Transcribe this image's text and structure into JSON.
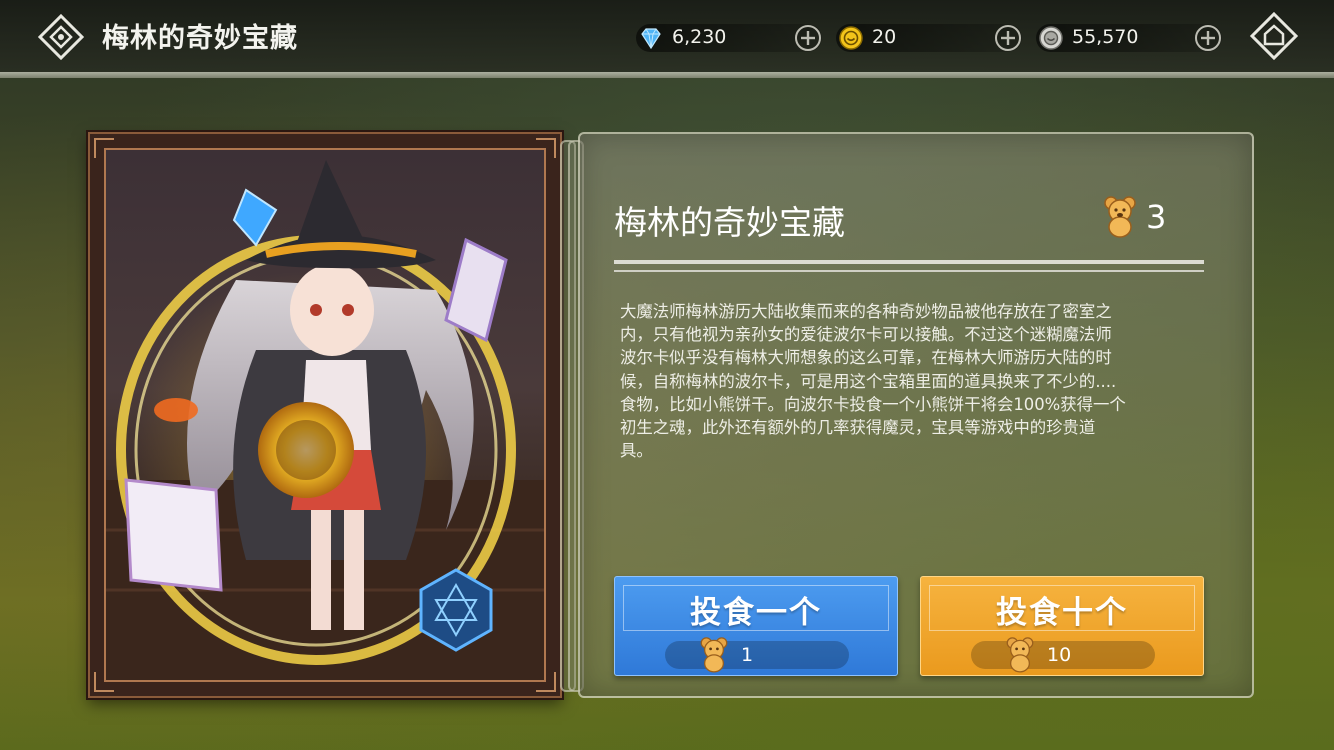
{
  "header": {
    "title": "梅林的奇妙宝藏",
    "back_icon": "diamond-back-icon",
    "home_icon": "home-icon"
  },
  "resources": [
    {
      "name": "diamond",
      "icon": "diamond-icon",
      "value": "6,230",
      "color": "#5fc3ff"
    },
    {
      "name": "gold-medal",
      "icon": "smile-coin-icon",
      "value": "20",
      "color": "#f2c61a"
    },
    {
      "name": "silver-coin",
      "icon": "silver-coin-icon",
      "value": "55,570",
      "color": "#c9c9c9"
    }
  ],
  "panel": {
    "title": "梅林的奇妙宝藏",
    "biscuit_count": "3",
    "description": "大魔法师梅林游历大陆收集而来的各种奇妙物品被他存放在了密室之\n内，只有他视为亲孙女的爱徒波尔卡可以接触。不过这个迷糊魔法师\n波尔卡似乎没有梅林大师想象的这么可靠，在梅林大师游历大陆的时\n候，自称梅林的波尔卡，可是用这个宝箱里面的道具换来了不少的....\n食物，比如小熊饼干。向波尔卡投食一个小熊饼干将会100%获得一个\n初生之魂，此外还有额外的几率获得魔灵，宝具等游戏中的珍贵道\n具。"
  },
  "buttons": {
    "feed_one": {
      "label": "投食一个",
      "cost": "1",
      "color": "#3a88e4"
    },
    "feed_ten": {
      "label": "投食十个",
      "cost": "10",
      "color": "#f0a72c"
    }
  },
  "card": {
    "art_icon": "witch-character-illustration"
  }
}
